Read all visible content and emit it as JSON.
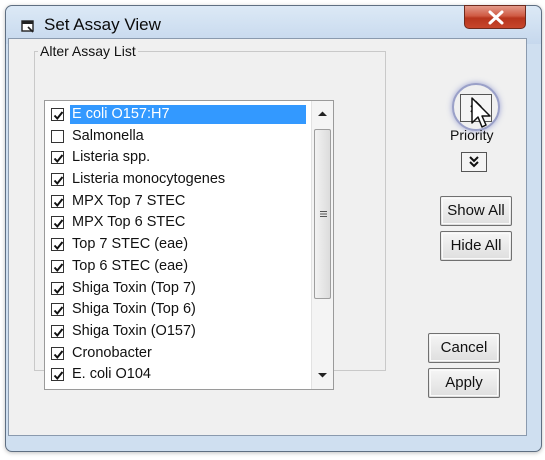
{
  "window": {
    "title": "Set Assay View"
  },
  "group": {
    "label": "Alter Assay List"
  },
  "assays": [
    {
      "label": "E coli O157:H7",
      "checked": true,
      "selected": true
    },
    {
      "label": "Salmonella",
      "checked": false,
      "selected": false
    },
    {
      "label": "Listeria spp.",
      "checked": true,
      "selected": false
    },
    {
      "label": "Listeria monocytogenes",
      "checked": true,
      "selected": false
    },
    {
      "label": "MPX Top 7 STEC",
      "checked": true,
      "selected": false
    },
    {
      "label": "MPX Top 6 STEC",
      "checked": true,
      "selected": false
    },
    {
      "label": "Top 7 STEC (eae)",
      "checked": true,
      "selected": false
    },
    {
      "label": "Top 6 STEC (eae)",
      "checked": true,
      "selected": false
    },
    {
      "label": "Shiga Toxin (Top 7)",
      "checked": true,
      "selected": false
    },
    {
      "label": "Shiga Toxin (Top 6)",
      "checked": true,
      "selected": false
    },
    {
      "label": "Shiga Toxin (O157)",
      "checked": true,
      "selected": false
    },
    {
      "label": "Cronobacter",
      "checked": true,
      "selected": false
    },
    {
      "label": "E. coli O104",
      "checked": true,
      "selected": false
    }
  ],
  "priority": {
    "label": "Priority",
    "up_icon": "double-chevron-up-icon",
    "down_icon": "double-chevron-down-icon"
  },
  "buttons": {
    "show_all": "Show All",
    "hide_all": "Hide All",
    "cancel": "Cancel",
    "apply": "Apply"
  },
  "colors": {
    "selection": "#3399ff",
    "close_button": "#c7462c",
    "frame": "#cfdff0"
  }
}
